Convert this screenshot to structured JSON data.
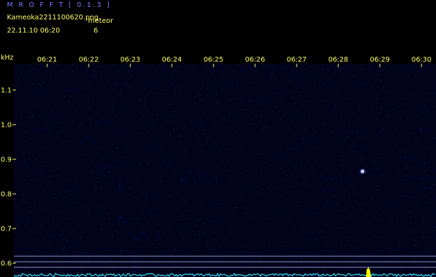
{
  "header": {
    "app_title": "M R O F F T  [ 0.1.3 ]",
    "file_name": "Kameoka2211100620.png",
    "meteor_label": "meteor",
    "datetime": "22.11.10 06:20",
    "meteor_count": "6"
  },
  "colors": {
    "background": "#000000",
    "plot_background": "#02021a",
    "noise": "#1e2a9a",
    "label": "#ffff66",
    "title": "#7a7cff",
    "tick": "#ffff66",
    "reference_line": "#8f9ccc",
    "signal": "#33e6ff",
    "echo": "#ffff00"
  },
  "chart_data": {
    "type": "heatmap",
    "ylabel": "kHz",
    "x_ticks": [
      "06:21",
      "06:22",
      "06:23",
      "06:24",
      "06:25",
      "06:26",
      "06:27",
      "06:28",
      "06:29",
      "06:30"
    ],
    "x_range": [
      "06:20",
      "06:30"
    ],
    "y_ticks": [
      0.6,
      0.7,
      0.8,
      0.9,
      1.0,
      1.1
    ],
    "y_range": [
      0.58,
      1.18
    ],
    "reference_lines_khz": [
      0.62,
      0.604,
      0.588
    ],
    "echoes": [
      {
        "time": "06:28:35",
        "freq_khz": 0.865
      },
      {
        "time": "06:28:43",
        "freq_khz": 0.582
      }
    ]
  }
}
